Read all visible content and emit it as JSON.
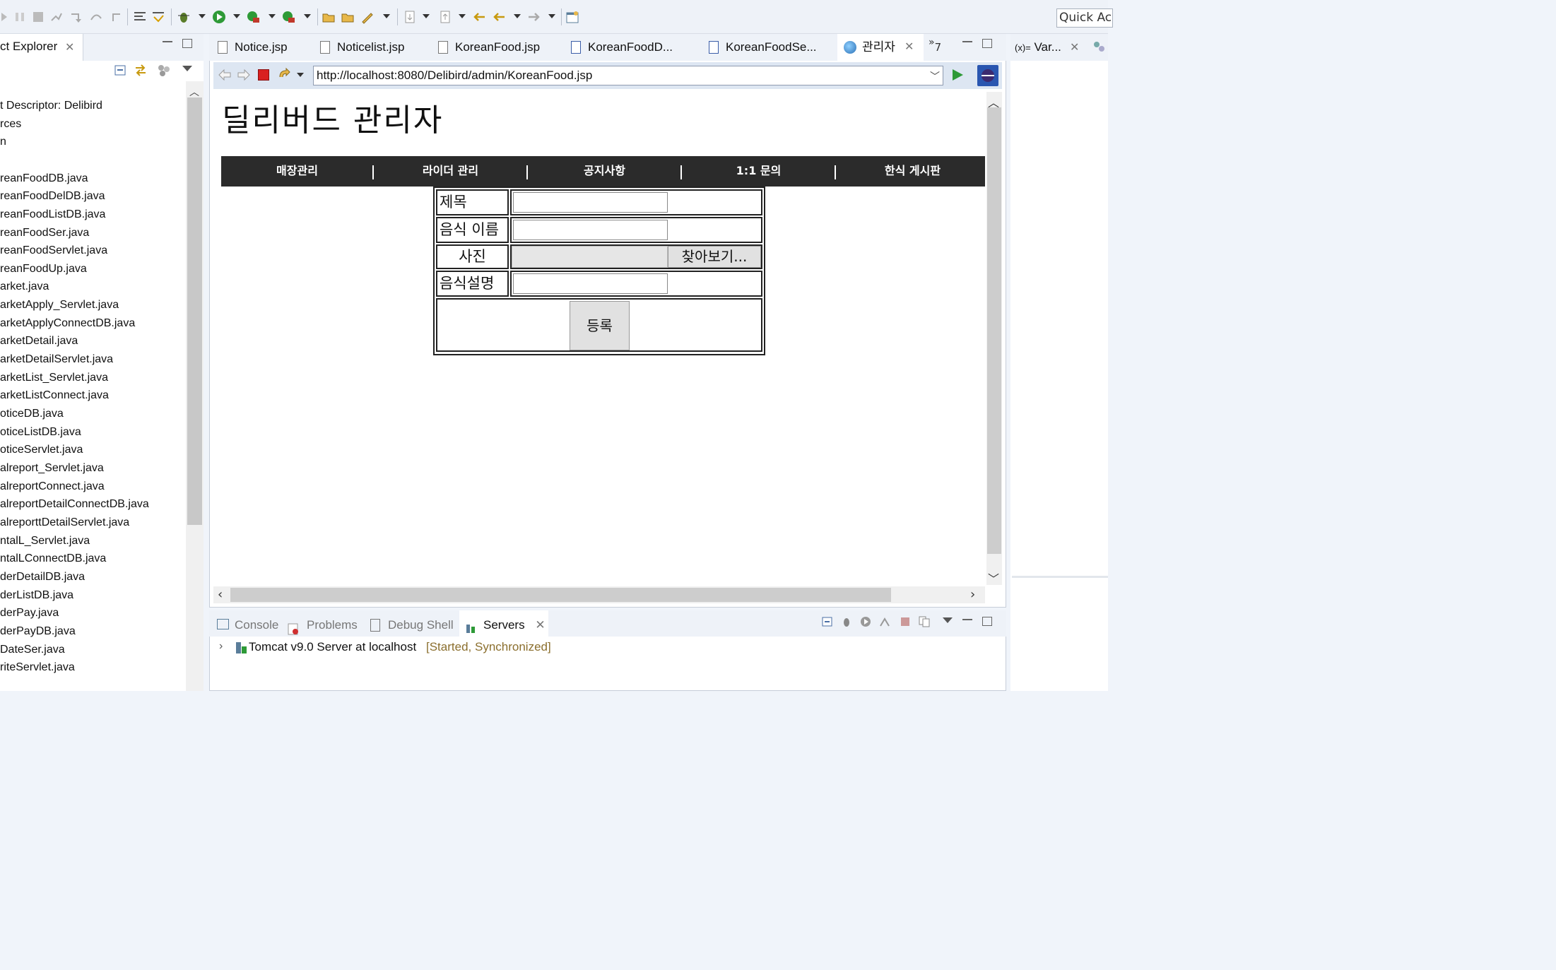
{
  "toolbar": {
    "quick_access": "Quick Access"
  },
  "explorer": {
    "tab_label": "ct Explorer",
    "items": [
      "t Descriptor: Delibird",
      "rces",
      "n",
      "reanFoodDB.java",
      "reanFoodDelDB.java",
      "reanFoodListDB.java",
      "reanFoodSer.java",
      "reanFoodServlet.java",
      "reanFoodUp.java",
      "arket.java",
      "arketApply_Servlet.java",
      "arketApplyConnectDB.java",
      "arketDetail.java",
      "arketDetailServlet.java",
      "arketList_Servlet.java",
      "arketListConnect.java",
      "oticeDB.java",
      "oticeListDB.java",
      "oticeServlet.java",
      "alreport_Servlet.java",
      "alreportConnect.java",
      "alreportDetailConnectDB.java",
      "alreporttDetailServlet.java",
      "ntalL_Servlet.java",
      "ntalLConnectDB.java",
      "derDetailDB.java",
      "derListDB.java",
      "derPay.java",
      "derPayDB.java",
      "DateSer.java",
      "riteServlet.java"
    ]
  },
  "editor": {
    "tabs": [
      {
        "label": "Notice.jsp",
        "icon": "jsp-file-icon"
      },
      {
        "label": "Noticelist.jsp",
        "icon": "jsp-file-icon"
      },
      {
        "label": "KoreanFood.jsp",
        "icon": "jsp-file-icon"
      },
      {
        "label": "KoreanFoodD...",
        "icon": "java-file-icon"
      },
      {
        "label": "KoreanFoodSe...",
        "icon": "java-file-icon"
      },
      {
        "label": "관리자",
        "icon": "globe-icon"
      }
    ],
    "more_tabs": "7",
    "url": "http://localhost:8080/Delibird/admin/KoreanFood.jsp"
  },
  "webpage": {
    "title": "딜리버드 관리자",
    "nav": [
      "매장관리",
      "라이더 관리",
      "공지사항",
      "1:1 문의",
      "한식 게시판"
    ],
    "form": {
      "title_label": "제목",
      "food_name_label": "음식 이름",
      "photo_label": "사진",
      "browse_button": "찾아보기...",
      "description_label": "음식설명",
      "submit_button": "등록"
    }
  },
  "right_panel": {
    "tab_label": "Var..."
  },
  "bottom_panel": {
    "tabs": [
      "Console",
      "Problems",
      "Debug Shell",
      "Servers"
    ],
    "active_tab": "Servers",
    "server_name": "Tomcat v9.0 Server at localhost",
    "server_status": "[Started, Synchronized]"
  },
  "colors": {
    "nav_bg": "#2b2b2b",
    "server_status": "#8b6f2e",
    "ide_chrome": "#eef2f8"
  }
}
